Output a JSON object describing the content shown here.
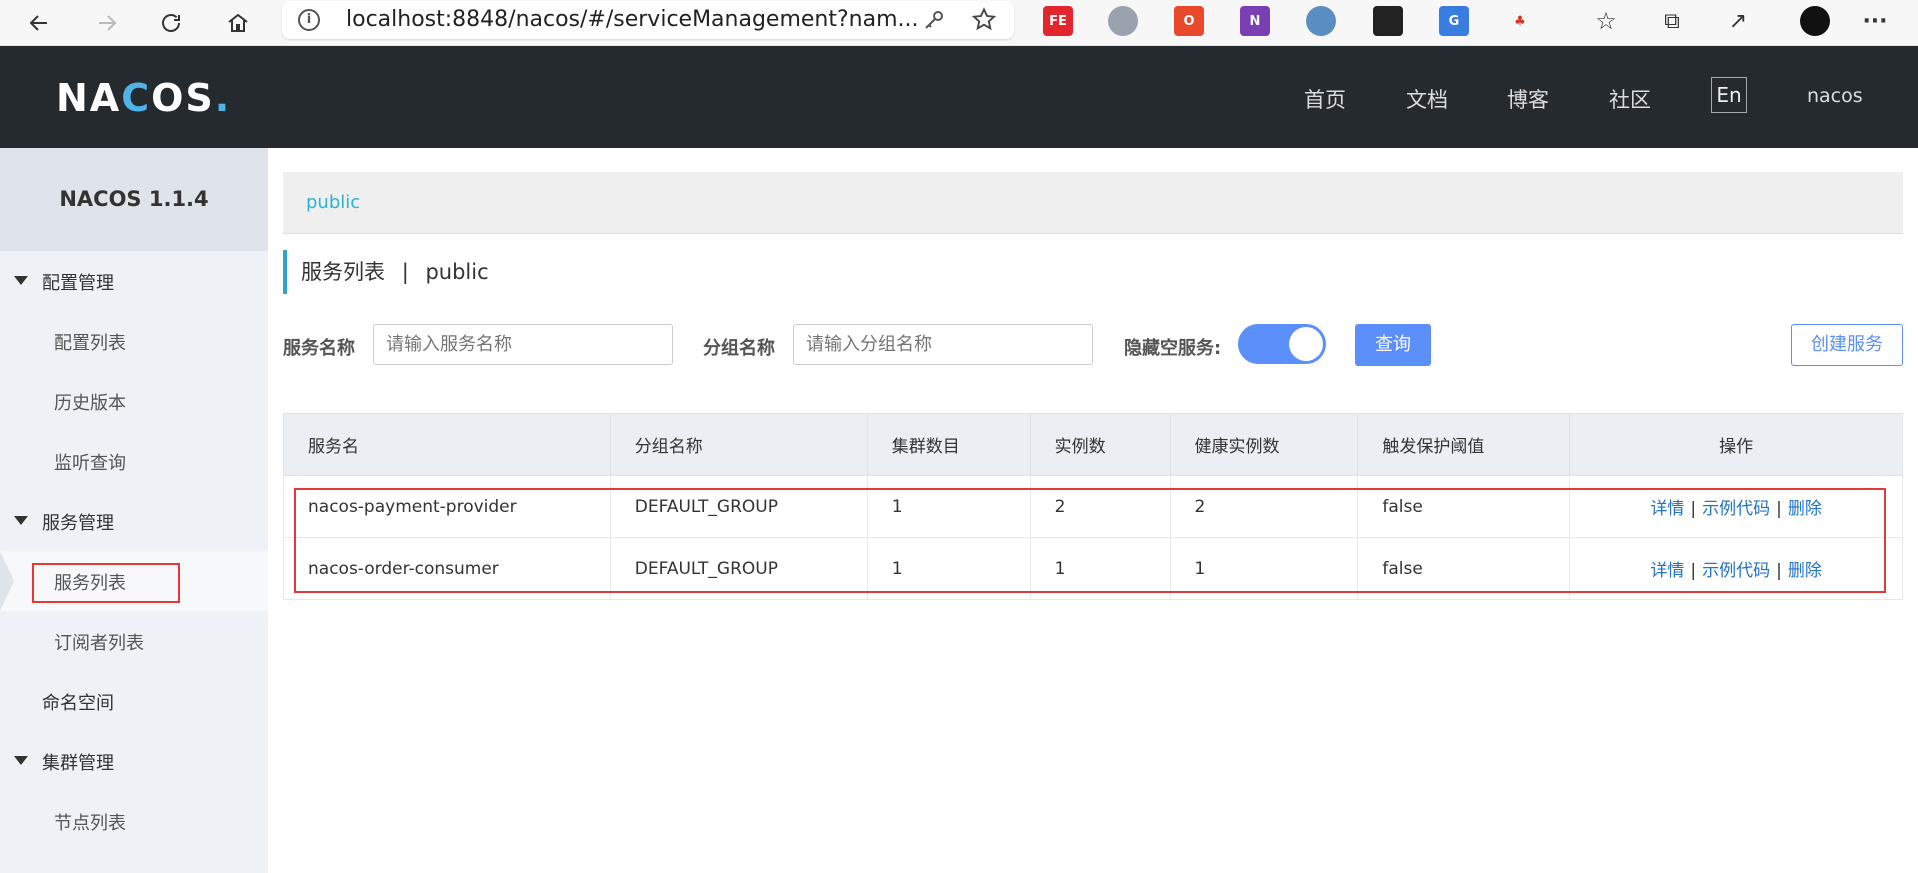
{
  "browser": {
    "url": "localhost:8848/nacos/#/serviceManagement?nam...",
    "extensions": [
      "FE",
      "globe",
      "office",
      "N",
      "spy",
      "mask",
      "translate",
      "org"
    ]
  },
  "header": {
    "logo": "NACOS.",
    "nav": [
      "首页",
      "文档",
      "博客",
      "社区"
    ],
    "lang": "En",
    "user": "nacos"
  },
  "sidebar": {
    "title": "NACOS 1.1.4",
    "groups": [
      {
        "label": "配置管理",
        "items": [
          "配置列表",
          "历史版本",
          "监听查询"
        ]
      },
      {
        "label": "服务管理",
        "items": [
          "服务列表",
          "订阅者列表"
        ]
      },
      {
        "label": "命名空间",
        "items": []
      },
      {
        "label": "集群管理",
        "items": [
          "节点列表"
        ]
      }
    ]
  },
  "main": {
    "namespace": "public",
    "title": "服务列表",
    "title_sep": "|",
    "title_ns": "public",
    "filters": {
      "service_label": "服务名称",
      "service_placeholder": "请输入服务名称",
      "group_label": "分组名称",
      "group_placeholder": "请输入分组名称",
      "hide_empty_label": "隐藏空服务:",
      "hide_empty_on": true,
      "query_label": "查询",
      "create_label": "创建服务"
    },
    "table": {
      "columns": [
        "服务名",
        "分组名称",
        "集群数目",
        "实例数",
        "健康实例数",
        "触发保护阈值",
        "操作"
      ],
      "rows": [
        {
          "name": "nacos-payment-provider",
          "group": "DEFAULT_GROUP",
          "clusters": "1",
          "instances": "2",
          "healthy": "2",
          "threshold": "false"
        },
        {
          "name": "nacos-order-consumer",
          "group": "DEFAULT_GROUP",
          "clusters": "1",
          "instances": "1",
          "healthy": "1",
          "threshold": "false"
        }
      ],
      "actions": {
        "detail": "详情",
        "sample": "示例代码",
        "delete": "删除",
        "sep": "|"
      }
    }
  }
}
